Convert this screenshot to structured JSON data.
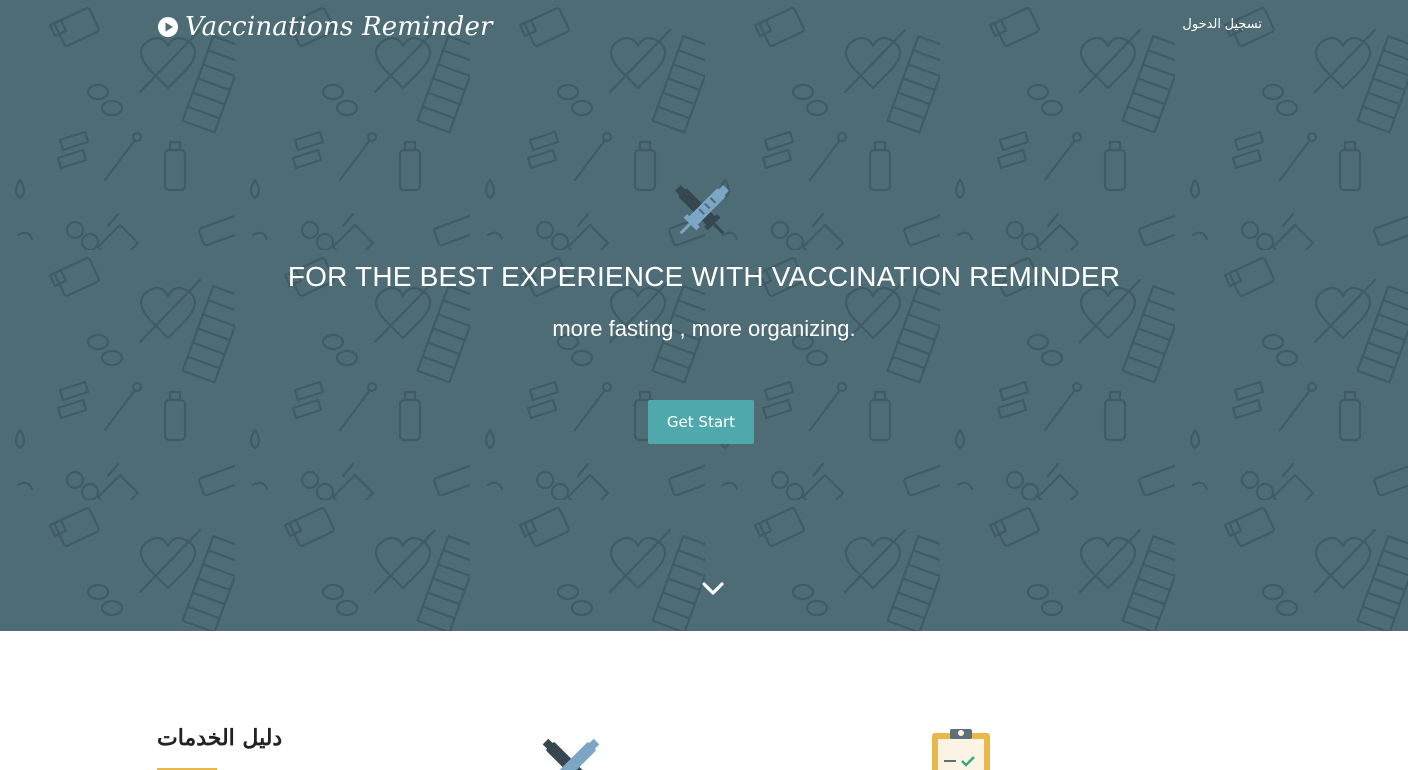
{
  "brand": {
    "name": "Vaccinations Reminder",
    "icon": "play-circle-icon"
  },
  "nav": {
    "login_label": "تسجيل الدخول"
  },
  "hero": {
    "background_color": "#4d6c76",
    "logo_icon": "crossed-syringes-icon",
    "title": "FOR THE BEST EXPERIENCE WITH VACCINATION REMINDER",
    "subtitle": "more fasting , more organizing.",
    "cta_label": "Get Start",
    "cta_color": "#4fa8ac",
    "scroll_icon": "chevron-down-icon"
  },
  "services": {
    "title": "دليل الخدمات",
    "accent_color": "#e8b84a",
    "icons": [
      "vaccine-syringes-icon",
      "clipboard-checklist-icon"
    ]
  }
}
